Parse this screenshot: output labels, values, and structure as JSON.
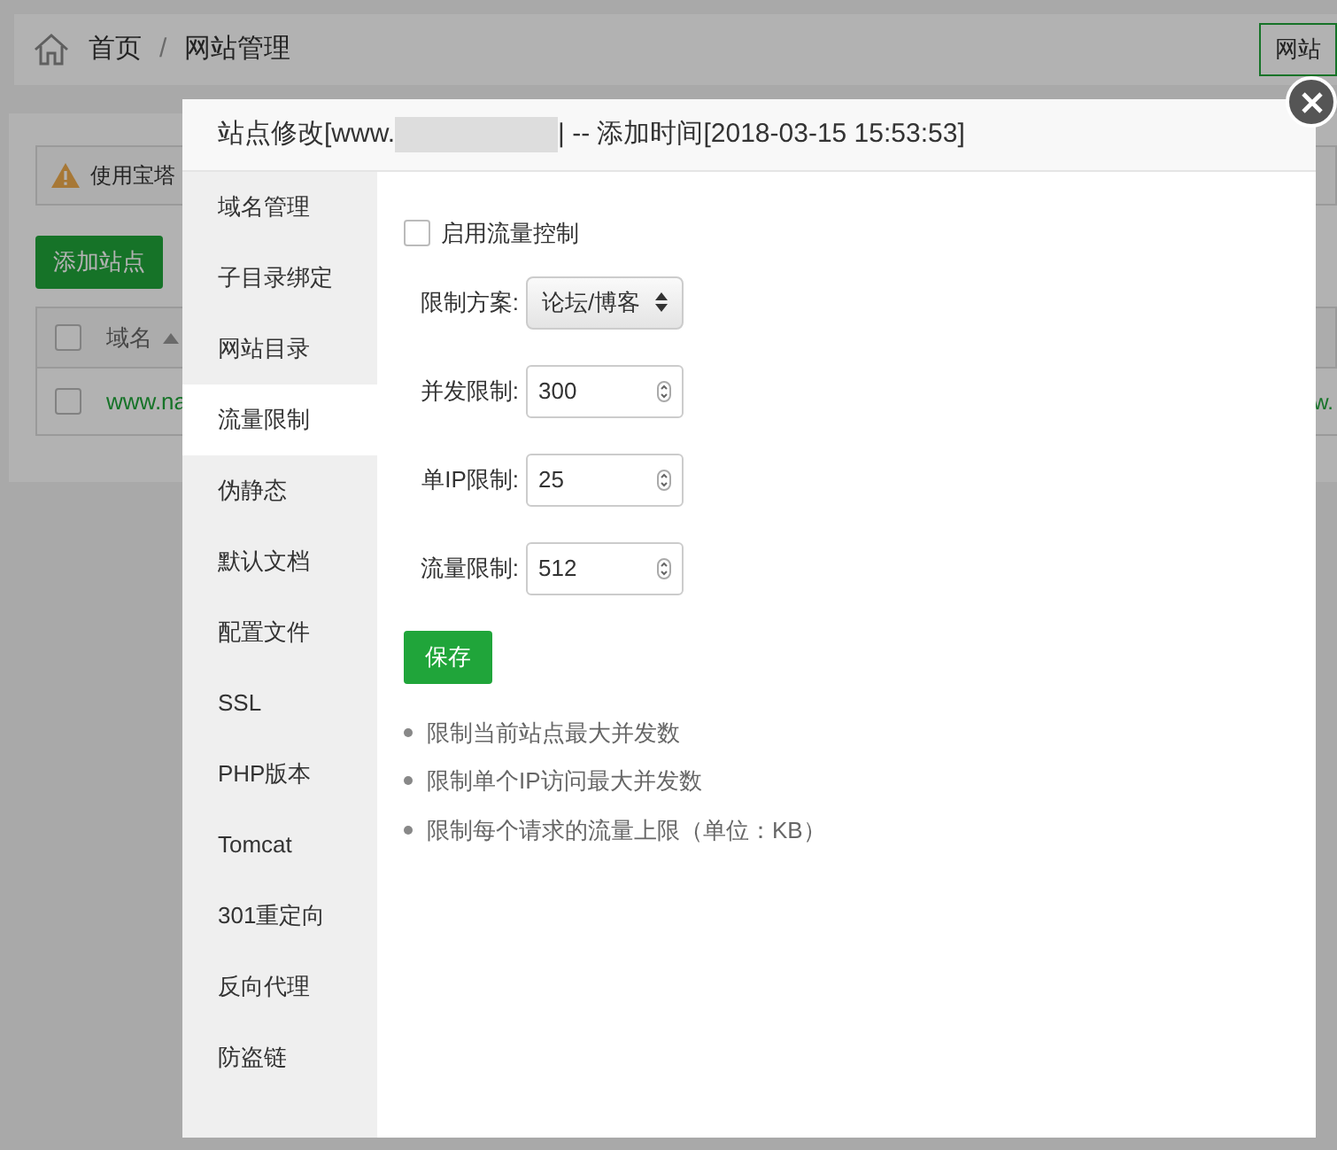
{
  "breadcrumb": {
    "items": [
      "首页",
      "网站管理"
    ],
    "separator": "/",
    "right_button": "网站"
  },
  "page": {
    "alert": "使用宝塔",
    "add_button": "添加站点",
    "table": {
      "header_checked": false,
      "column_1": "域名",
      "rows": [
        {
          "checked": false,
          "domain": "www.na",
          "column_end": "w."
        }
      ]
    }
  },
  "modal": {
    "title_prefix": "站点修改[www.",
    "title_suffix": "| -- 添加时间[2018-03-15 15:53:53]",
    "sidebar": [
      {
        "label": "域名管理",
        "selected": false
      },
      {
        "label": "子目录绑定",
        "selected": false
      },
      {
        "label": "网站目录",
        "selected": false
      },
      {
        "label": "流量限制",
        "selected": true
      },
      {
        "label": "伪静态",
        "selected": false
      },
      {
        "label": "默认文档",
        "selected": false
      },
      {
        "label": "配置文件",
        "selected": false
      },
      {
        "label": "SSL",
        "selected": false
      },
      {
        "label": "PHP版本",
        "selected": false
      },
      {
        "label": "Tomcat",
        "selected": false
      },
      {
        "label": "301重定向",
        "selected": false
      },
      {
        "label": "反向代理",
        "selected": false
      },
      {
        "label": "防盗链",
        "selected": false
      }
    ],
    "enable": {
      "label": "启用流量控制",
      "checked": false
    },
    "fields": [
      {
        "kind": "select",
        "label": "限制方案:",
        "value": "论坛/博客"
      },
      {
        "kind": "number",
        "label": "并发限制:",
        "value": "300"
      },
      {
        "kind": "number",
        "label": "单IP限制:",
        "value": "25"
      },
      {
        "kind": "number",
        "label": "流量限制:",
        "value": "512"
      }
    ],
    "save_button": "保存",
    "notes": [
      "限制当前站点最大并发数",
      "限制单个IP访问最大并发数",
      "限制每个请求的流量上限（单位：KB）"
    ]
  }
}
